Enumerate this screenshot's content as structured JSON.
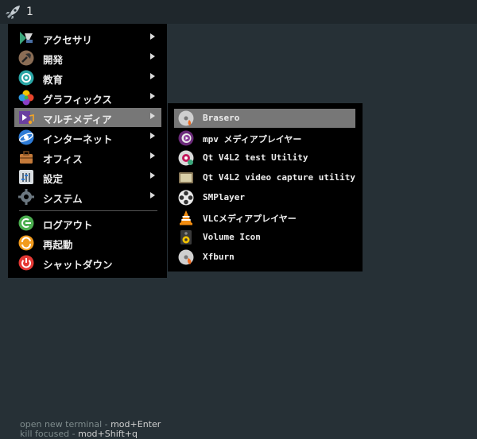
{
  "topbar": {
    "workspace": "1"
  },
  "main_menu": {
    "items": [
      {
        "label": "アクセサリ",
        "icon": "accessories-icon",
        "has_submenu": true
      },
      {
        "label": "開発",
        "icon": "development-icon",
        "has_submenu": true
      },
      {
        "label": "教育",
        "icon": "education-icon",
        "has_submenu": true
      },
      {
        "label": "グラフィックス",
        "icon": "graphics-icon",
        "has_submenu": true
      },
      {
        "label": "マルチメディア",
        "icon": "multimedia-icon",
        "has_submenu": true,
        "highlighted": true
      },
      {
        "label": "インターネット",
        "icon": "internet-icon",
        "has_submenu": true
      },
      {
        "label": "オフィス",
        "icon": "office-icon",
        "has_submenu": true
      },
      {
        "label": "設定",
        "icon": "settings-icon",
        "has_submenu": true
      },
      {
        "label": "システム",
        "icon": "system-icon",
        "has_submenu": true
      }
    ],
    "session": [
      {
        "label": "ログアウト",
        "icon": "logout-icon"
      },
      {
        "label": "再起動",
        "icon": "reboot-icon"
      },
      {
        "label": "シャットダウン",
        "icon": "shutdown-icon"
      }
    ]
  },
  "sub_menu": {
    "items": [
      {
        "label": "Brasero",
        "icon": "brasero-icon",
        "highlighted": true
      },
      {
        "label": "mpv メディアプレイヤー",
        "icon": "mpv-icon"
      },
      {
        "label": "Qt V4L2 test Utility",
        "icon": "qv4l2-icon"
      },
      {
        "label": "Qt V4L2 video capture utility",
        "icon": "qvidcap-icon"
      },
      {
        "label": "SMPlayer",
        "icon": "smplayer-icon"
      },
      {
        "label": "VLCメディアプレイヤー",
        "icon": "vlc-icon"
      },
      {
        "label": "Volume Icon",
        "icon": "volume-icon"
      },
      {
        "label": "Xfburn",
        "icon": "xfburn-icon"
      }
    ]
  },
  "hints": [
    {
      "text": "open new terminal - ",
      "key": "mod+Enter"
    },
    {
      "text": "kill focused - ",
      "key": "mod+Shift+q"
    }
  ],
  "colors": {
    "background": "#263036",
    "menu": "#000000",
    "highlight": "#777777"
  }
}
